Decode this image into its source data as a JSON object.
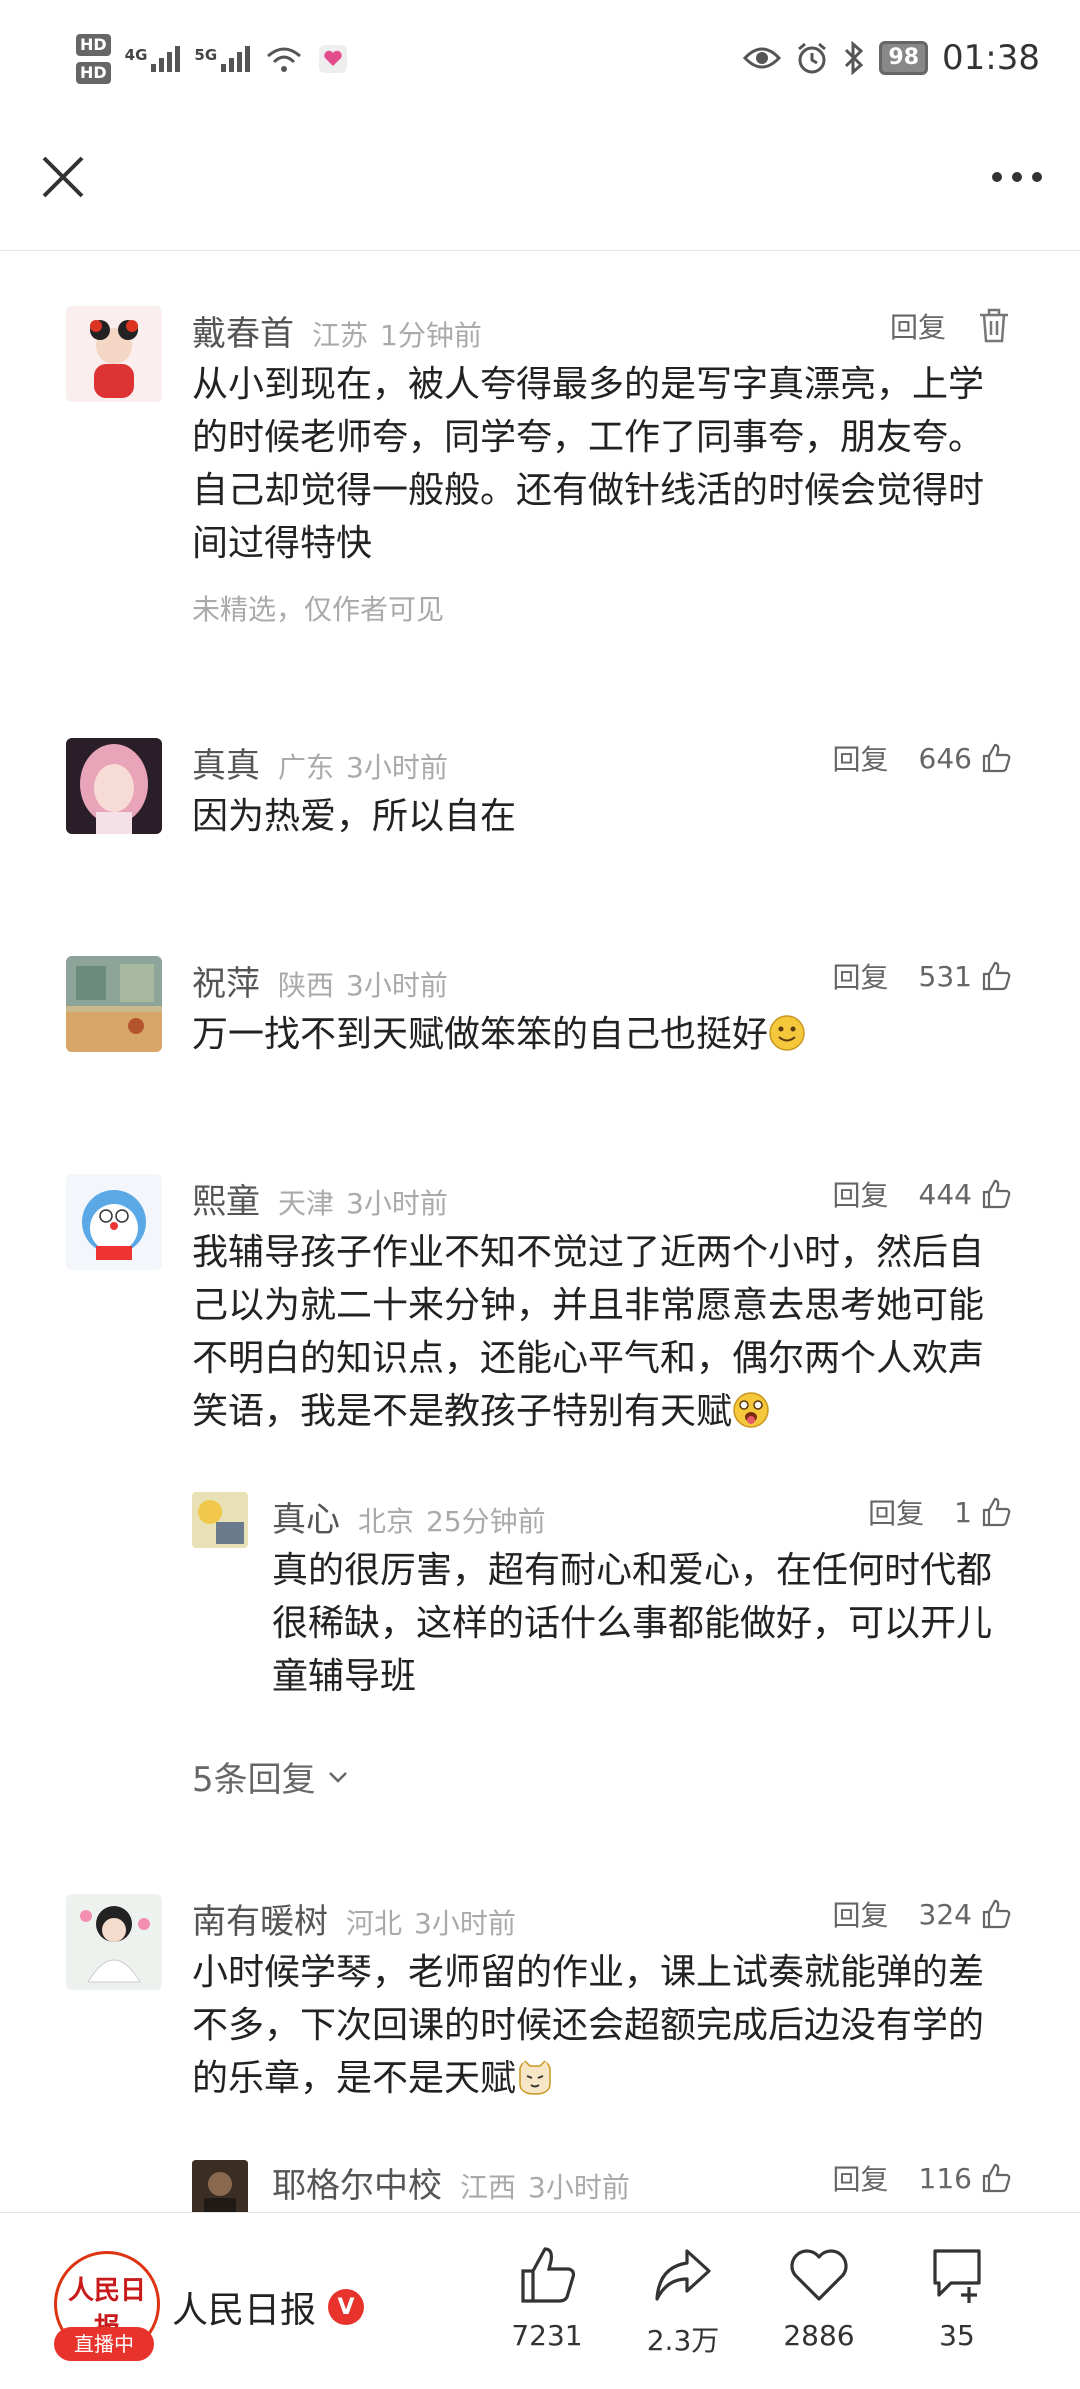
{
  "status_bar": {
    "hd1": "HD",
    "hd2": "HD",
    "net1": "4G",
    "net2": "5G",
    "battery": "98",
    "time": "01:38"
  },
  "comments": [
    {
      "name": "戴春首",
      "region": "江苏",
      "time": "1分钟前",
      "reply": "回复",
      "text": "从小到现在，被人夸得最多的是写字真漂亮，上学的时候老师夸，同学夸，工作了同事夸，朋友夸。自己却觉得一般般。还有做针线活的时候会觉得时间过得特快",
      "note": "未精选，仅作者可见"
    },
    {
      "name": "真真",
      "region": "广东",
      "time": "3小时前",
      "reply": "回复",
      "likes": "646",
      "text": "因为热爱，所以自在"
    },
    {
      "name": "祝萍",
      "region": "陕西",
      "time": "3小时前",
      "reply": "回复",
      "likes": "531",
      "text": "万一找不到天赋做笨笨的自己也挺好"
    },
    {
      "name": "熙童",
      "region": "天津",
      "time": "3小时前",
      "reply": "回复",
      "likes": "444",
      "text": "我辅导孩子作业不知不觉过了近两个小时，然后自己以为就二十来分钟，并且非常愿意去思考她可能不明白的知识点，还能心平气和，偶尔两个人欢声笑语，我是不是教孩子特别有天赋",
      "subreply": {
        "name": "真心",
        "region": "北京",
        "time": "25分钟前",
        "reply": "回复",
        "likes": "1",
        "text": "真的很厉害，超有耐心和爱心，在任何时代都很稀缺，这样的话什么事都能做好，可以开儿童辅导班"
      },
      "more_replies": "5条回复"
    },
    {
      "name": "南有暖树",
      "region": "河北",
      "time": "3小时前",
      "reply": "回复",
      "likes": "324",
      "text": "小时候学琴，老师留的作业，课上试奏就能弹的差不多，下次回课的时候还会超额完成后边没有学的的乐章，是不是天赋",
      "subreply": {
        "name": "耶格尔中校",
        "region": "江西",
        "time": "3小时前",
        "reply": "回复",
        "likes": "116"
      }
    }
  ],
  "bottom_bar": {
    "logo_text": "人民日报",
    "live_label": "直播中",
    "publisher": "人民日报",
    "verified": "V",
    "likes": "7231",
    "shares": "2.3万",
    "favorites": "2886",
    "comments": "35"
  },
  "colors": {
    "accent_red": "#e8322c",
    "text_primary": "#222222",
    "text_muted": "#aaaaaa"
  }
}
